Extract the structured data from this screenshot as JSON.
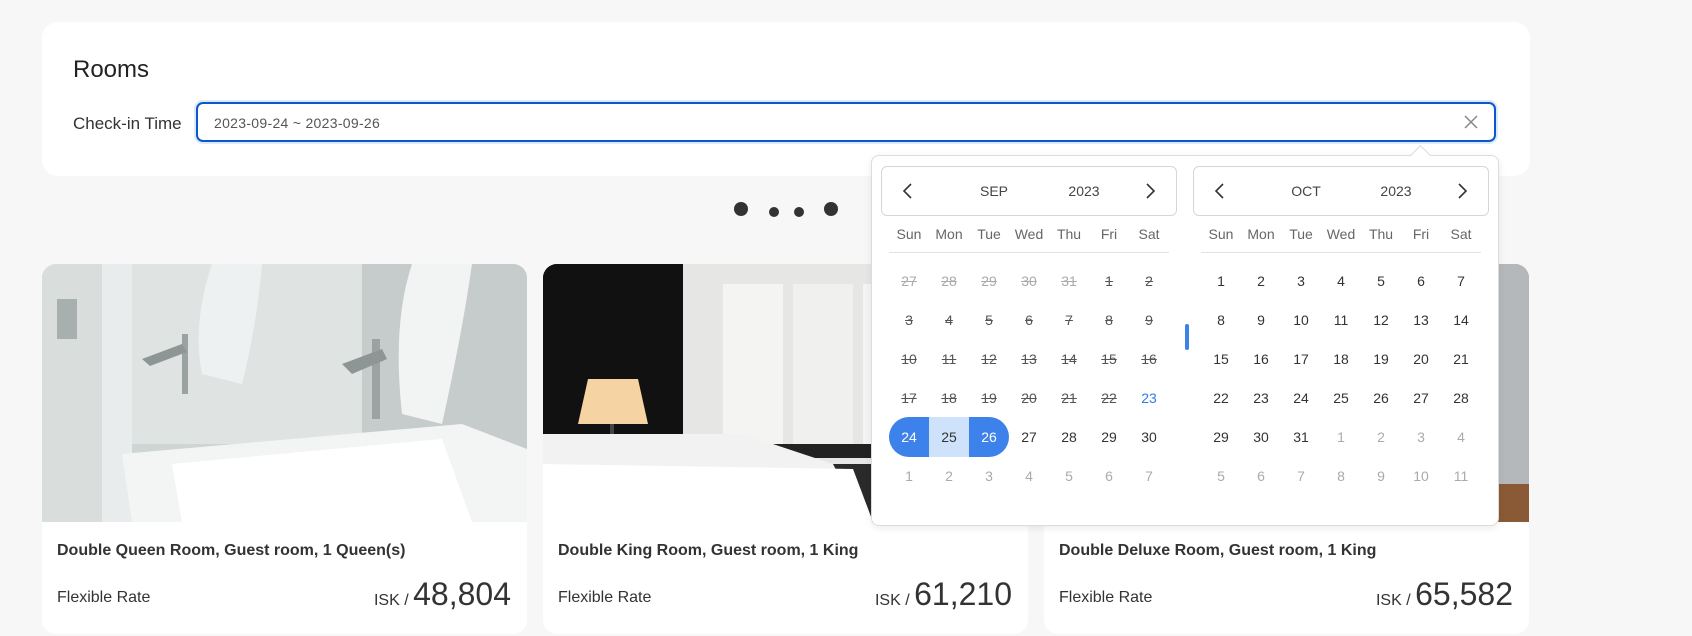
{
  "panel": {
    "title": "Rooms",
    "checkin_label": "Check-in Time",
    "date_value": "2023-09-24 ~ 2023-09-26"
  },
  "weekdays": [
    "Sun",
    "Mon",
    "Tue",
    "Wed",
    "Thu",
    "Fri",
    "Sat"
  ],
  "calendars": [
    {
      "month": "SEP",
      "year": "2023",
      "days": [
        [
          "27",
          "28",
          "29",
          "30",
          "31",
          "1",
          "2"
        ],
        [
          "3",
          "4",
          "5",
          "6",
          "7",
          "8",
          "9"
        ],
        [
          "10",
          "11",
          "12",
          "13",
          "14",
          "15",
          "16"
        ],
        [
          "17",
          "18",
          "19",
          "20",
          "21",
          "22",
          "23"
        ],
        [
          "24",
          "25",
          "26",
          "27",
          "28",
          "29",
          "30"
        ],
        [
          "1",
          "2",
          "3",
          "4",
          "5",
          "6",
          "7"
        ]
      ]
    },
    {
      "month": "OCT",
      "year": "2023",
      "days": [
        [
          "1",
          "2",
          "3",
          "4",
          "5",
          "6",
          "7"
        ],
        [
          "8",
          "9",
          "10",
          "11",
          "12",
          "13",
          "14"
        ],
        [
          "15",
          "16",
          "17",
          "18",
          "19",
          "20",
          "21"
        ],
        [
          "22",
          "23",
          "24",
          "25",
          "26",
          "27",
          "28"
        ],
        [
          "29",
          "30",
          "31",
          "1",
          "2",
          "3",
          "4"
        ],
        [
          "5",
          "6",
          "7",
          "8",
          "9",
          "10",
          "11"
        ]
      ]
    }
  ],
  "selection": {
    "start": "2023-09-24",
    "end": "2023-09-26",
    "today": "2023-09-23"
  },
  "cards": [
    {
      "title": "Double Queen Room, Guest room, 1 Queen(s)",
      "rate": "Flexible Rate",
      "currency": "ISK /",
      "price": "48,804"
    },
    {
      "title": "Double King Room, Guest room, 1 King",
      "rate": "Flexible Rate",
      "currency": "ISK /",
      "price": "61,210"
    },
    {
      "title": "Double Deluxe Room, Guest room, 1 King",
      "rate": "Flexible Rate",
      "currency": "ISK /",
      "price": "65,582"
    }
  ],
  "colors": {
    "accent": "#3d82ea",
    "range": "#cfe2fb",
    "focus_border": "#0a58ca"
  },
  "icons": {
    "clear": "close-icon",
    "prev": "chevron-left-icon",
    "next": "chevron-right-icon"
  }
}
